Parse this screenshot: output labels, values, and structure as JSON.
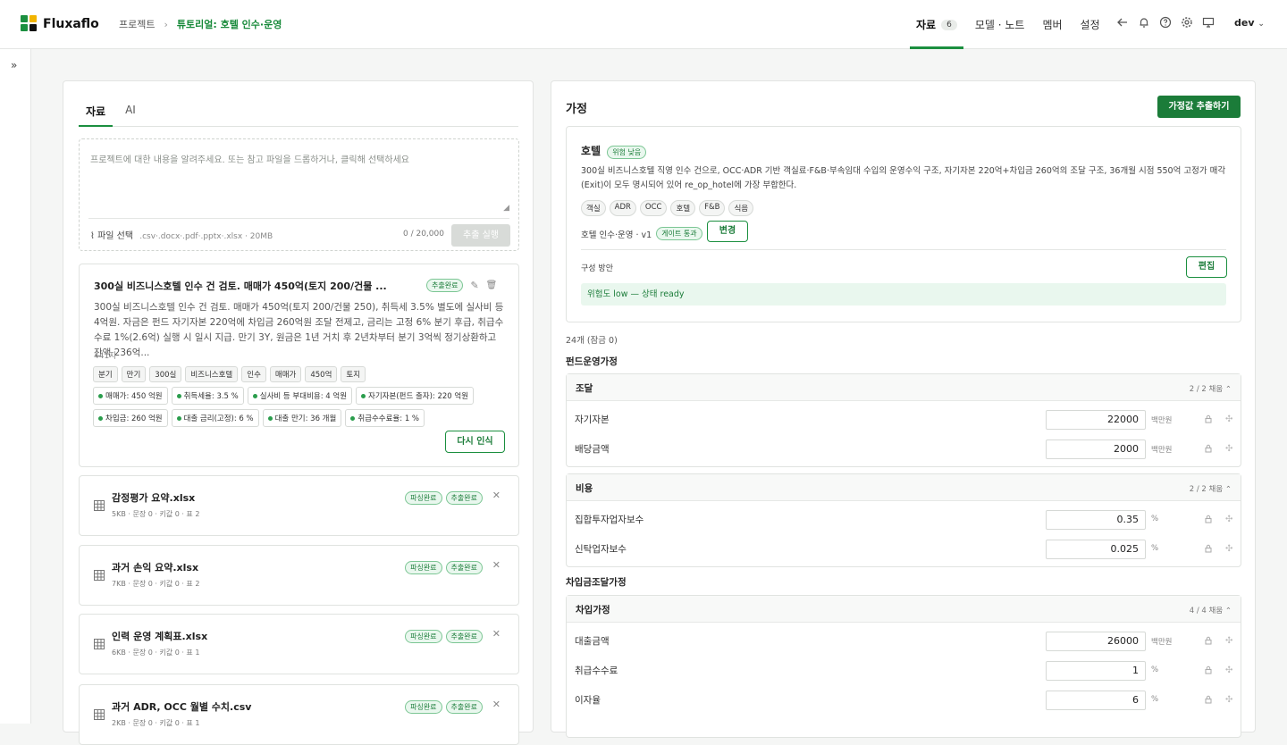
{
  "app": {
    "name": "Fluxaflo"
  },
  "breadcrumb": {
    "root": "프로젝트",
    "sep": "›",
    "current": "튜토리얼: 호텔 인수·운영"
  },
  "nav": {
    "items": [
      {
        "label": "자료",
        "count": "6"
      },
      {
        "label": "모델 · 노트"
      },
      {
        "label": "멤버"
      },
      {
        "label": "설정"
      }
    ]
  },
  "user": {
    "name": "dev"
  },
  "colors": {
    "accent": "#1b8f3f",
    "accent_dark": "#1b7c39",
    "badge_bg": "#e9f7ee"
  },
  "left": {
    "tabs": [
      "자료",
      "AI"
    ],
    "input": {
      "placeholder": "프로젝트에 대한 내용을 알려주세요. 또는 참고 파일을 드롭하거나, 클릭해 선택하세요",
      "file_label": "파일 선택",
      "file_types": ".csv·.docx·.pdf·.pptx·.xlsx · 20MB",
      "counter": "0 / 20,000",
      "run_label": "추출 실행"
    },
    "note": {
      "title": "300실 비즈니스호텔 인수 건 검토. 매매가 450억(토지 200/건물 ...",
      "status": "추출완료",
      "body": "300실 비즈니스호텔 인수 건 검토. 매매가 450억(토지 200/건물 250), 취득세 3.5% 별도에 실사비 등 4억원. 자금은 펀드 자기자본 220억에 차입금 260억원 조달 전제고, 금리는 고정 6% 분기 후급, 취급수수료 1%(2.6억) 실행 시 일시 지급. 만기 3Y, 원금은 1년 거치 후 2년차부터 분기 3억씩 정기상환하고 잔액 236억...",
      "chars": "441자",
      "keywords": [
        "분기",
        "만기",
        "300실",
        "비즈니스호텔",
        "인수",
        "매매가",
        "450억",
        "토지"
      ],
      "values": [
        "매매가: 450 억원",
        "취득세율: 3.5 %",
        "실사비 등 부대비용: 4 억원",
        "자기자본(펀드 출자): 220 억원",
        "차입금: 260 억원",
        "대출 금리(고정): 6 %",
        "대출 만기: 36 개월",
        "취급수수료율: 1 %"
      ],
      "retry_label": "다시 인식"
    },
    "files": [
      {
        "name": "감정평가 요약.xlsx",
        "meta": "5KB · 문장 0 · 키값 0 · 표 2",
        "badges": [
          "파싱완료",
          "추출완료"
        ]
      },
      {
        "name": "과거 손익 요약.xlsx",
        "meta": "7KB · 문장 0 · 키값 0 · 표 2",
        "badges": [
          "파싱완료",
          "추출완료"
        ]
      },
      {
        "name": "인력 운영 계획표.xlsx",
        "meta": "6KB · 문장 0 · 키값 0 · 표 1",
        "badges": [
          "파싱완료",
          "추출완료"
        ]
      },
      {
        "name": "과거 ADR, OCC 월별 수치.csv",
        "meta": "2KB · 문장 0 · 키값 0 · 표 1",
        "badges": [
          "파싱완료",
          "추출완료"
        ]
      }
    ]
  },
  "right": {
    "title": "가정",
    "extract_label": "가정값 추출하기",
    "hotel": {
      "name": "호텔",
      "risk": "위험 낮음",
      "desc": "300실 비즈니스호텔 직영 인수 건으로, OCC·ADR 기반 객실료·F&B·부속임대 수입의 운영수익 구조, 자기자본 220억+차입금 260억의 조달 구조, 36개월 시점 550억 고정가 매각(Exit)이 모두 명시되어 있어 re_op_hotel에 가장 부합한다.",
      "tags": [
        "객실",
        "ADR",
        "OCC",
        "호텔",
        "F&B",
        "식음"
      ],
      "model": "호텔 인수·운영 · v1",
      "gate": "게이트 통과",
      "change_label": "변경",
      "plan_label": "구성 방안",
      "edit_label": "편집",
      "ready": "위험도 low — 상태 ready"
    },
    "stat": "24개 (잠금 0)",
    "section1": "펀드운영가정",
    "section2": "차입금조달가정",
    "groups": [
      {
        "title": "조달",
        "count": "2 / 2 채움",
        "rows": [
          {
            "label": "자기자본",
            "value": "22000",
            "unit": "백만원"
          },
          {
            "label": "배당금액",
            "value": "2000",
            "unit": "백만원"
          }
        ]
      },
      {
        "title": "비용",
        "count": "2 / 2 채움",
        "rows": [
          {
            "label": "집합투자업자보수",
            "value": "0.35",
            "unit": "%"
          },
          {
            "label": "신탁업자보수",
            "value": "0.025",
            "unit": "%"
          }
        ]
      },
      {
        "title": "차입가정",
        "count": "4 / 4 채움",
        "rows": [
          {
            "label": "대출금액",
            "value": "26000",
            "unit": "백만원"
          },
          {
            "label": "취급수수료",
            "value": "1",
            "unit": "%"
          },
          {
            "label": "이자율",
            "value": "6",
            "unit": "%"
          }
        ]
      }
    ]
  }
}
